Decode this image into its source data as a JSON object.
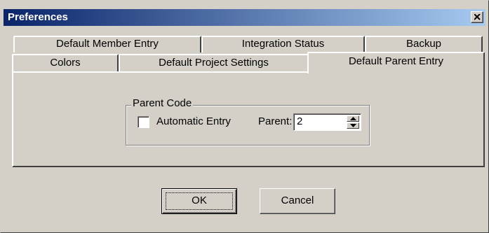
{
  "window": {
    "title": "Preferences",
    "close_icon": "close-x-icon"
  },
  "tabs": {
    "row_back": [
      {
        "label": "Default Member Entry"
      },
      {
        "label": "Integration Status"
      },
      {
        "label": "Backup"
      }
    ],
    "row_front": [
      {
        "label": "Colors"
      },
      {
        "label": "Default Project Settings"
      },
      {
        "label": "Default Parent Entry",
        "selected": true
      }
    ]
  },
  "parent_code": {
    "group_label": "Parent Code",
    "automatic_entry_label": "Automatic Entry",
    "automatic_entry_checked": false,
    "parent_label": "Parent:",
    "parent_value": "2"
  },
  "buttons": {
    "ok_label": "OK",
    "cancel_label": "Cancel"
  },
  "colors": {
    "titlebar_start": "#0a246a",
    "titlebar_end": "#a6caf0",
    "face": "#d4d0c8"
  }
}
